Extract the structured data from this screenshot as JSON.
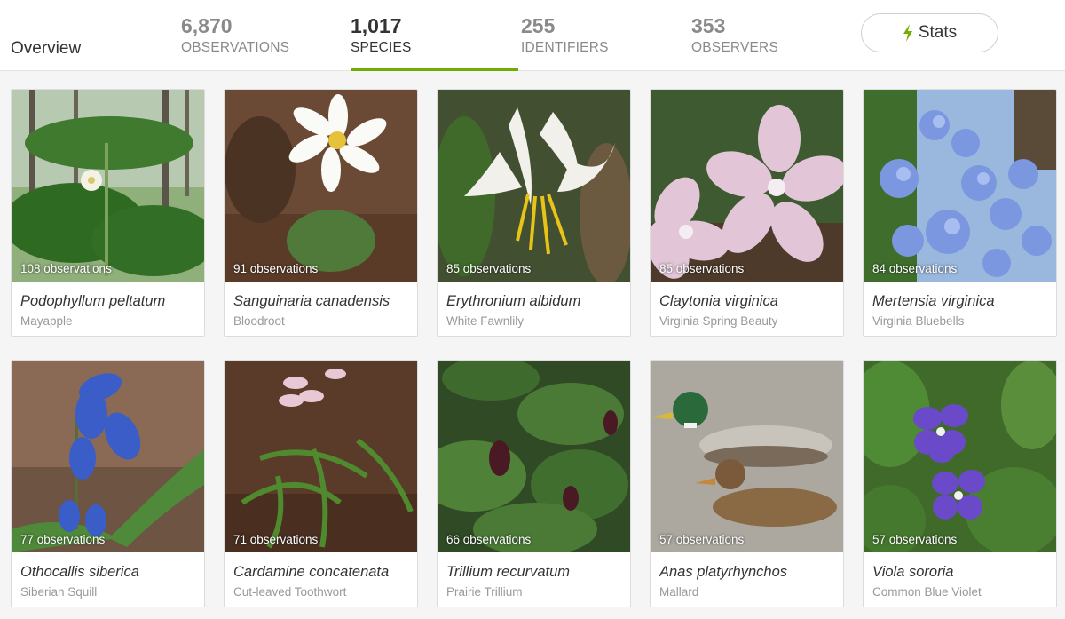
{
  "header": {
    "overview_label": "Overview",
    "stats": [
      {
        "value": "6,870",
        "label": "OBSERVATIONS"
      },
      {
        "value": "1,017",
        "label": "SPECIES"
      },
      {
        "value": "255",
        "label": "IDENTIFIERS"
      },
      {
        "value": "353",
        "label": "OBSERVERS"
      }
    ],
    "stats_button_label": "Stats",
    "accent_color": "#74ac00"
  },
  "species": [
    {
      "scientific": "Podophyllum peltatum",
      "common": "Mayapple",
      "count": "108 observations"
    },
    {
      "scientific": "Sanguinaria canadensis",
      "common": "Bloodroot",
      "count": "91 observations"
    },
    {
      "scientific": "Erythronium albidum",
      "common": "White Fawnlily",
      "count": "85 observations"
    },
    {
      "scientific": "Claytonia virginica",
      "common": "Virginia Spring Beauty",
      "count": "85 observations"
    },
    {
      "scientific": "Mertensia virginica",
      "common": "Virginia Bluebells",
      "count": "84 observations"
    },
    {
      "scientific": "Othocallis siberica",
      "common": "Siberian Squill",
      "count": "77 observations"
    },
    {
      "scientific": "Cardamine concatenata",
      "common": "Cut-leaved Toothwort",
      "count": "71 observations"
    },
    {
      "scientific": "Trillium recurvatum",
      "common": "Prairie Trillium",
      "count": "66 observations"
    },
    {
      "scientific": "Anas platyrhynchos",
      "common": "Mallard",
      "count": "57 observations"
    },
    {
      "scientific": "Viola sororia",
      "common": "Common Blue Violet",
      "count": "57 observations"
    }
  ]
}
